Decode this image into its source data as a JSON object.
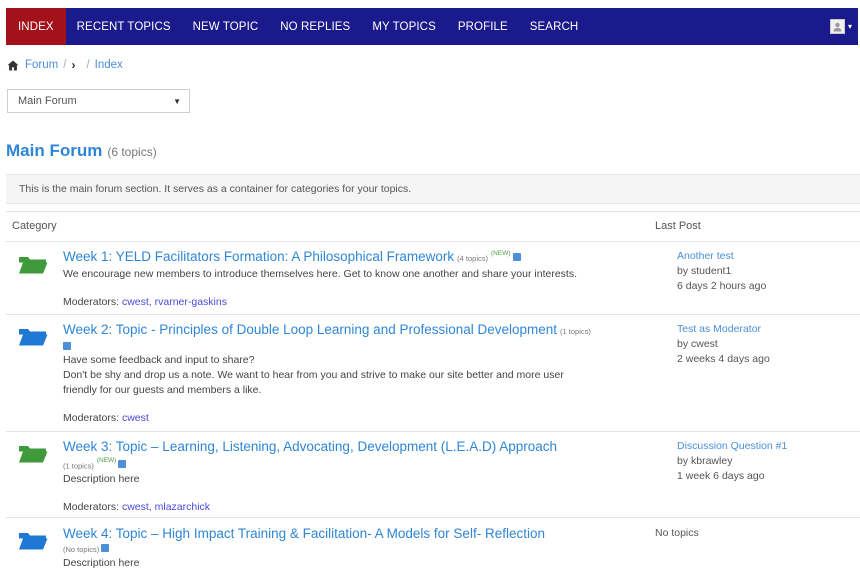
{
  "nav": {
    "items": [
      "INDEX",
      "RECENT TOPICS",
      "NEW TOPIC",
      "NO REPLIES",
      "MY TOPICS",
      "PROFILE",
      "SEARCH"
    ],
    "active": "INDEX"
  },
  "breadcrumb": {
    "forum": "Forum",
    "separator": "/",
    "index": "Index"
  },
  "forum_select": {
    "selected": "Main Forum"
  },
  "forum": {
    "name": "Main Forum",
    "count": "(6 topics)",
    "description": "This is the main forum section. It serves as a container for categories for your topics."
  },
  "table": {
    "category_header": "Category",
    "last_post_header": "Last Post"
  },
  "categories": [
    {
      "title": "Week 1: YELD Facilitators Formation: A Philosophical Framework",
      "count": "(4 topics)",
      "new": "(NEW)",
      "description": [
        "We encourage new members to introduce themselves here. Get to know one another and share your interests."
      ],
      "moderators_label": "Moderators:",
      "moderators": "cwest, rvarner-gaskins",
      "last_post": {
        "title": "Another test",
        "by": "by student1",
        "when": "6 days 2 hours ago"
      }
    },
    {
      "title": "Week 2: Topic - Principles of Double Loop Learning and Professional Development",
      "count": "(1 topics)",
      "new": "",
      "description": [
        "Have some feedback and input to share?",
        "Don't be shy and drop us a note. We want to hear from you and strive to make our site better and more user",
        "friendly for our guests and members a like."
      ],
      "moderators_label": "Moderators:",
      "moderators": "cwest",
      "last_post": {
        "title": "Test as Moderator",
        "by": "by cwest",
        "when": "2 weeks 4 days ago"
      }
    },
    {
      "title": "Week 3: Topic – Learning, Listening, Advocating, Development (L.E.A.D) Approach",
      "count": "(1 topics)",
      "new": "(NEW)",
      "description": [
        "Description here"
      ],
      "moderators_label": "Moderators:",
      "moderators": "cwest, mlazarchick",
      "last_post": {
        "title": "Discussion Question #1",
        "by": "by kbrawley",
        "when": "1 week 6 days ago"
      }
    },
    {
      "title": "Week 4: Topic – High Impact Training & Facilitation- A Models for Self- Reflection",
      "count": "(No topics)",
      "new": "",
      "description": [
        "Description here"
      ],
      "no_topics": "No topics"
    }
  ],
  "colors": {
    "nav_bg": "#1a1a8c",
    "nav_active": "#a3111a",
    "link": "#2f86d6",
    "folder_green": "#3f9a3c",
    "folder_blue": "#1e78d4"
  },
  "icons": [
    "home-icon",
    "chevron-right-icon",
    "folder-icon",
    "rss-icon",
    "avatar-icon",
    "caret-down-icon"
  ]
}
